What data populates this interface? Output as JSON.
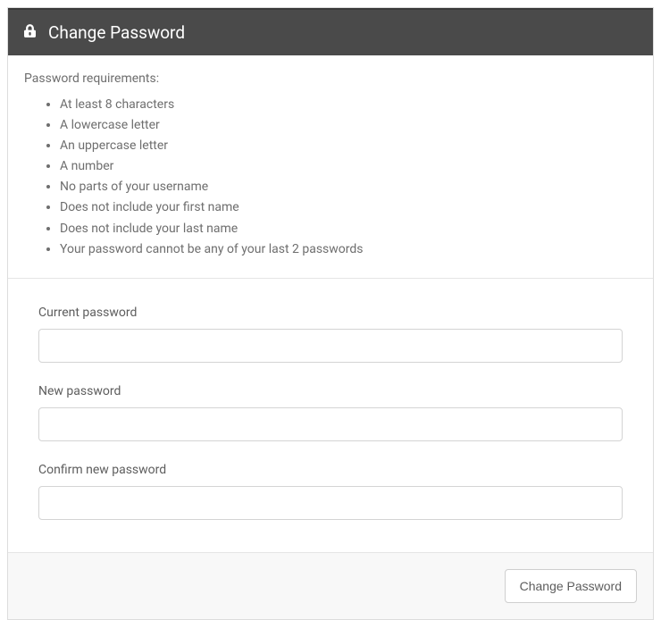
{
  "header": {
    "title": "Change Password"
  },
  "requirements": {
    "intro": "Password requirements:",
    "items": [
      "At least 8 characters",
      "A lowercase letter",
      "An uppercase letter",
      "A number",
      "No parts of your username",
      "Does not include your first name",
      "Does not include your last name",
      "Your password cannot be any of your last 2 passwords"
    ]
  },
  "form": {
    "current_label": "Current password",
    "new_label": "New password",
    "confirm_label": "Confirm new password",
    "current_value": "",
    "new_value": "",
    "confirm_value": ""
  },
  "footer": {
    "submit_label": "Change Password"
  }
}
